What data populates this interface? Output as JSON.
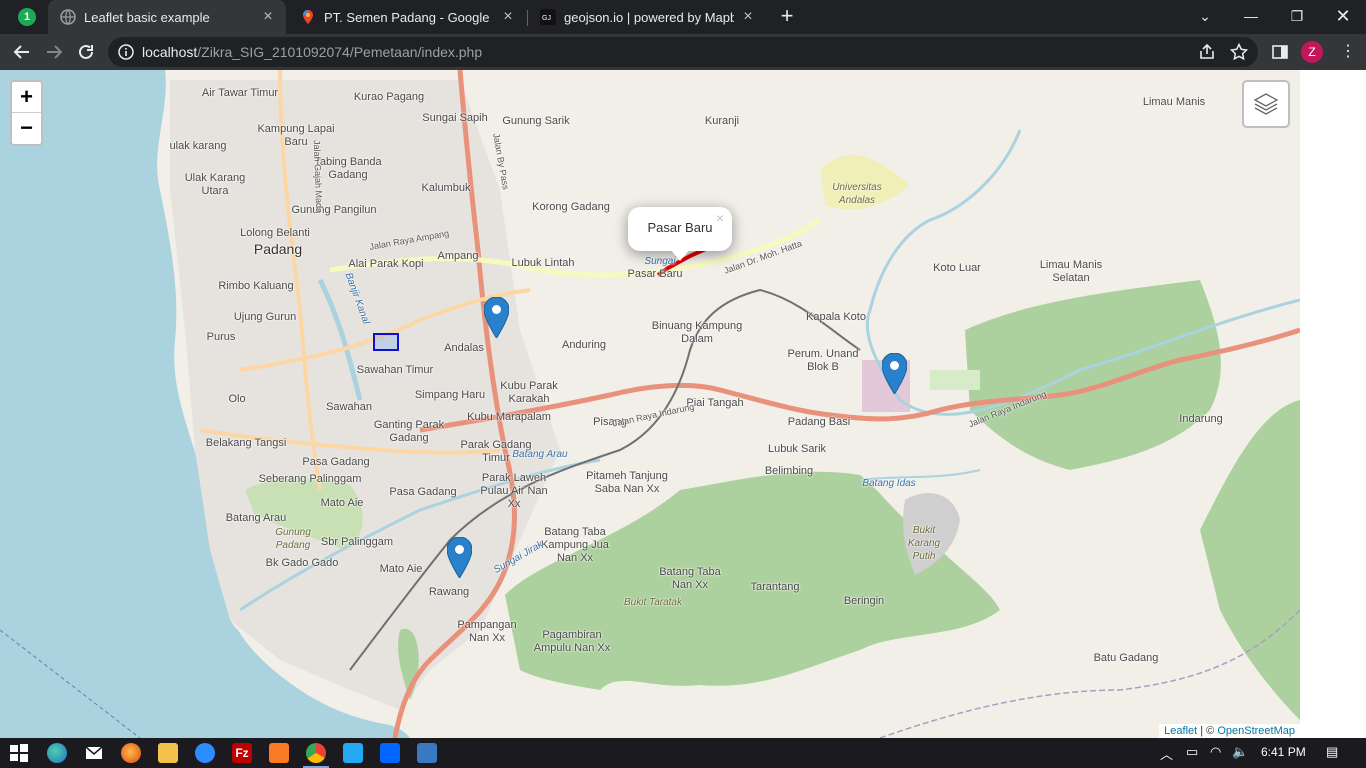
{
  "browser": {
    "app_badge": "1",
    "tabs": [
      {
        "title": "Leaflet basic example",
        "icon": "globe-icon",
        "active": true
      },
      {
        "title": "PT. Semen Padang - Google Map",
        "icon": "google-maps-icon",
        "active": false
      },
      {
        "title": "geojson.io | powered by Mapbox",
        "icon": "geojson-icon",
        "active": false
      }
    ],
    "url_host": "localhost",
    "url_path": "/Zikra_SIG_2101092074/Pemetaan/index.php",
    "profile_initial": "Z"
  },
  "map": {
    "zoom_in": "+",
    "zoom_out": "−",
    "popup": {
      "text": "Pasar Baru",
      "close": "×"
    },
    "attribution": {
      "leaflet": "Leaflet",
      "sep": " | © ",
      "osm": "OpenStreetMap"
    },
    "markers": 3,
    "place_labels": [
      "Air Tawar Timur",
      "Kurao Pagang",
      "Sungai Sapih",
      "Gunung Sarik",
      "Kuranji",
      "Kampung Lapai Baru",
      "ulak karang",
      "Tabing Banda Gadang",
      "Ulak Karang Utara",
      "Kalumbuk",
      "Gunung Pangilun",
      "Korong Gadang",
      "Universitas Andalas",
      "Lolong Belanti",
      "Padang",
      "Alai Parak Kopi",
      "Ampang",
      "Lubuk Lintah",
      "Pasar Baru",
      "Koto Luar",
      "Limau Manis Selatan",
      "Limau Manis",
      "Rimbo Kaluang",
      "Ujung Gurun",
      "Purus",
      "Binuang Kampung Dalam",
      "Kapala Koto",
      "Andalas",
      "Anduring",
      "Sawahan Timur",
      "Perum. Unand Blok B",
      "Olo",
      "Simpang Haru",
      "Kubu Parak Karakah",
      "Piai Tangah",
      "Indarung",
      "Sawahan",
      "Kubu Marapalam",
      "Pisang",
      "Padang Basi",
      "Belakang Tangsi",
      "Ganting Parak Gadang",
      "Parak Gadang Timur",
      "Lubuk Sarik",
      "Pasa Gadang",
      "Belimbing",
      "Seberang Palinggam",
      "Pitameh Tanjung Saba Nan Xx",
      "Parak Laweh Pulau Air Nan Xx",
      "Mato Aie",
      "Pasa Gadang",
      "Batang Arau",
      "Gunung Padang",
      "Sbr Palinggam",
      "Batang Taba Kampung Jua Nan Xx",
      "Bukit Karang Putih",
      "Bk Gado Gado",
      "Mato Aie",
      "Rawang",
      "Batang Taba Nan Xx",
      "Tarantang",
      "Beringin",
      "Bukit Taratak",
      "Pampangan Nan Xx",
      "Pagambiran Ampulu Nan Xx",
      "Batu Gadang"
    ],
    "water_labels": [
      "Banjir Kanal",
      "Batang Arau",
      "Batang Idas",
      "Sungai Jirak",
      "Sungai"
    ],
    "road_labels": [
      "Jalan Raya Ampang",
      "Jalan By Pass",
      "Jalan Raya Indarung",
      "Jalan Dr. Moh. Hatta",
      "Jalan Gajah Mada"
    ]
  },
  "taskbar": {
    "apps": [
      "windows-start",
      "edge",
      "mail",
      "firefox",
      "file-explorer",
      "zoom",
      "filezilla",
      "xampp",
      "chrome",
      "vscode",
      "power-automate",
      "photos"
    ],
    "time": "6:41 PM"
  }
}
